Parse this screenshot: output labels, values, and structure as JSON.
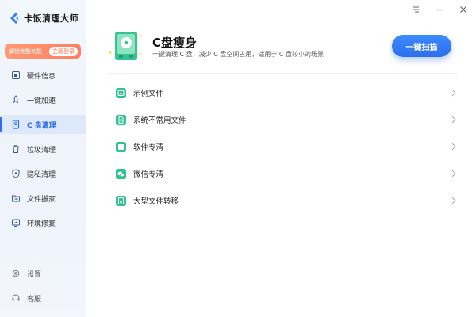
{
  "app": {
    "name": "卡饭清理大师"
  },
  "promo": {
    "text": "解锁完整功能",
    "button": "立即登录"
  },
  "sidebar": {
    "items": [
      {
        "label": "硬件信息",
        "icon": "hardware-icon"
      },
      {
        "label": "一键加速",
        "icon": "rocket-icon"
      },
      {
        "label": "C 盘清理",
        "icon": "disk-clean-icon",
        "active": true
      },
      {
        "label": "垃圾清理",
        "icon": "trash-icon"
      },
      {
        "label": "隐私清理",
        "icon": "privacy-shield-icon"
      },
      {
        "label": "文件搬家",
        "icon": "folder-move-icon"
      },
      {
        "label": "环境修复",
        "icon": "repair-icon"
      }
    ],
    "bottom": [
      {
        "label": "设置",
        "icon": "gear-icon"
      },
      {
        "label": "客服",
        "icon": "headset-icon"
      }
    ]
  },
  "header": {
    "title": "C盘瘦身",
    "description": "一键清理 C 盘，减少 C 盘空间占用，适用于 C 盘较小的场景",
    "scan_button": "一键扫描"
  },
  "list": [
    {
      "label": "示例文件",
      "icon": "image-icon"
    },
    {
      "label": "系统不常用文件",
      "icon": "document-icon"
    },
    {
      "label": "软件专清",
      "icon": "apps-grid-icon"
    },
    {
      "label": "微信专清",
      "icon": "wechat-icon"
    },
    {
      "label": "大型文件转移",
      "icon": "file-transfer-icon"
    }
  ],
  "colors": {
    "accent": "#2f6fe9",
    "promo": "#ff8763",
    "item_icon": "#2fc48f"
  }
}
